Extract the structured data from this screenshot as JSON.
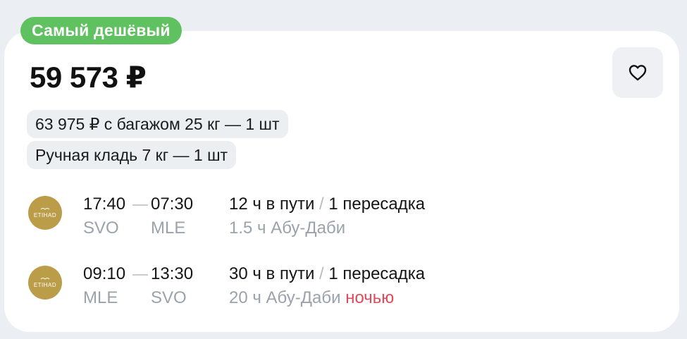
{
  "badge": {
    "label": "Самый дешёвый",
    "color": "#5fc160"
  },
  "price": {
    "main": "59 573 ₽"
  },
  "favorite": {
    "icon": "heart-icon"
  },
  "options": {
    "baggage": "63 975 ₽ с багажом 25 кг — 1 шт",
    "hand_luggage": "Ручная кладь 7 кг — 1 шт"
  },
  "flights": [
    {
      "airline_logo": "etihad-logo-icon",
      "dep_time": "17:40",
      "arr_time": "07:30",
      "dep_code": "SVO",
      "arr_code": "MLE",
      "duration": "12 ч в пути",
      "transfers": "1 пересадка",
      "layover": "1.5 ч Абу-Даби",
      "layover_note": ""
    },
    {
      "airline_logo": "etihad-logo-icon",
      "dep_time": "09:10",
      "arr_time": "13:30",
      "dep_code": "MLE",
      "arr_code": "SVO",
      "duration": "30 ч в пути",
      "transfers": "1 пересадка",
      "layover": "20 ч Абу-Даби",
      "layover_note": "ночью"
    }
  ]
}
